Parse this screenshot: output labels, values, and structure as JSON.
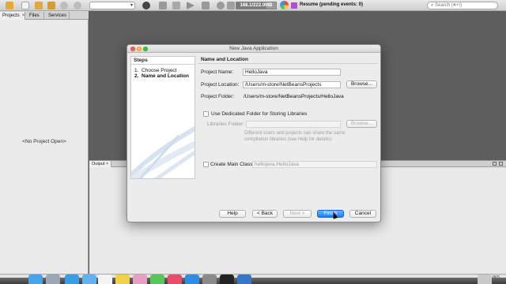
{
  "toolbar": {
    "memory_label": "168.1/222.0MB",
    "memory_fraction": 0.76,
    "status_text": "Resume (pending events: 0)",
    "search_placeholder": "Search (⌘+I)",
    "search_icon": "magnifier-icon",
    "icons": [
      "new-folder-icon",
      "new-file-icon",
      "open-project-icon",
      "close-project-icon",
      "undo-icon",
      "redo-icon",
      "config-combo",
      "globe-icon",
      "hammer-icon",
      "clean-build-icon",
      "run-icon",
      "debug-icon",
      "profile-icon",
      "step-icon"
    ]
  },
  "left_panel": {
    "tabs": [
      {
        "label": "Projects",
        "active": true,
        "close": "×"
      },
      {
        "label": "Files",
        "active": false,
        "close": ""
      },
      {
        "label": "Services",
        "active": false,
        "close": ""
      }
    ],
    "empty_text": "<No Project Open>"
  },
  "output": {
    "tab_label": "Output",
    "close": "×"
  },
  "statusbar": {
    "mode": "INS"
  },
  "dialog": {
    "title": "New Java Application",
    "steps_header": "Steps",
    "steps": [
      {
        "num": "1.",
        "label": "Choose Project",
        "current": false
      },
      {
        "num": "2.",
        "label": "Name and Location",
        "current": true
      }
    ],
    "section_header": "Name and Location",
    "project_name_label": "Project Name:",
    "project_name_value": "HelloJava",
    "project_location_label": "Project Location:",
    "project_location_value": "/Users/m-store/NetBeansProjects",
    "project_folder_label": "Project Folder:",
    "project_folder_value": "/Users/m-store/NetBeansProjects/HelloJava",
    "browse_label": "Browse...",
    "dedicated_folder_label": "Use Dedicated Folder for Storing Libraries",
    "dedicated_folder_checked": false,
    "libraries_folder_label": "Libraries Folder:",
    "libraries_folder_value": "",
    "libraries_help": "Different users and projects can share the same compilation libraries (see Help for details).",
    "create_main_class_label": "Create Main Class",
    "create_main_class_checked": false,
    "main_class_value": "hellojava.HelloJava",
    "buttons": {
      "help": "Help",
      "back": "< Back",
      "next": "Next >",
      "finish": "Finish",
      "cancel": "Cancel"
    }
  },
  "colors": {
    "primary_button": "#1a7ff0",
    "close_light": "#fc605c",
    "minimize_light": "#fdbc40",
    "zoom_light": "#34c84a"
  },
  "dock": {
    "icons": [
      "finder-icon",
      "launchpad-icon",
      "safari-icon",
      "mail-icon",
      "calendar-icon",
      "notes-icon",
      "photos-icon",
      "messages-icon",
      "music-icon",
      "app-store-icon",
      "settings-icon",
      "terminal-icon",
      "netbeans-icon",
      "trash-icon"
    ]
  }
}
